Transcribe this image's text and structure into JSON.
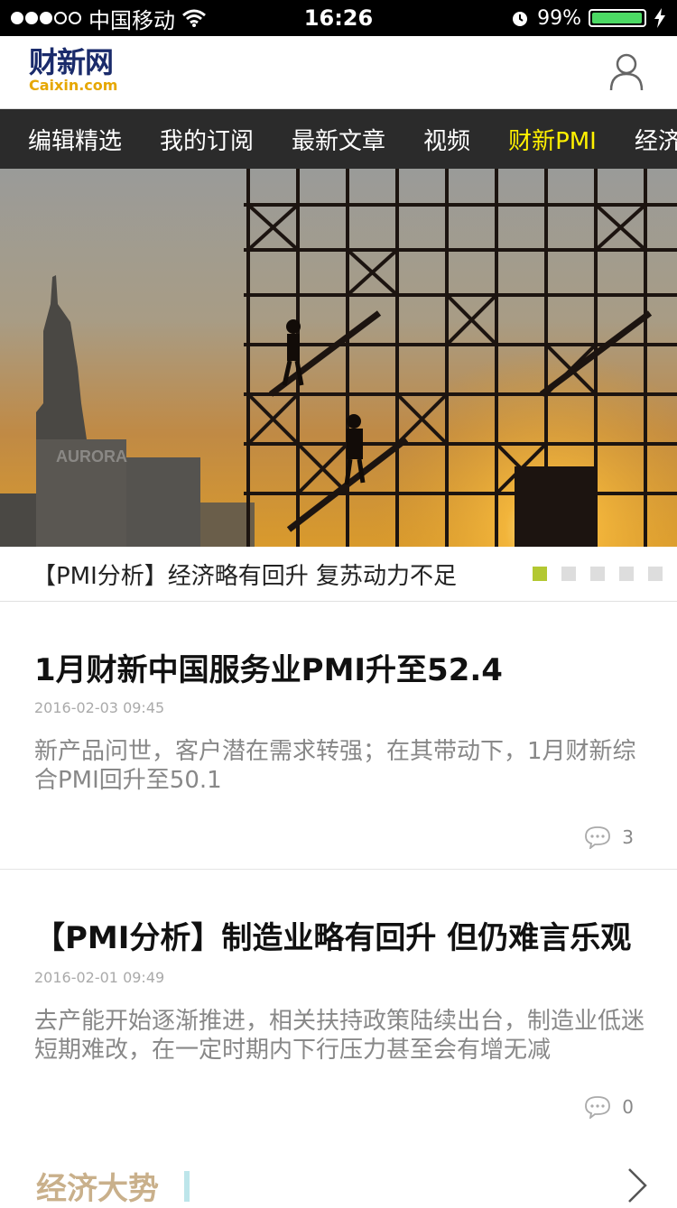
{
  "status_bar": {
    "carrier": "中国移动",
    "time": "16:26",
    "battery": "99%",
    "battery_level": 0.99
  },
  "header": {
    "logo_cn": "财新网",
    "logo_en": "Caixin.com"
  },
  "nav": {
    "tabs": [
      "编辑精选",
      "我的订阅",
      "最新文章",
      "视频",
      "财新PMI",
      "经济"
    ],
    "active_index": 4
  },
  "hero": {
    "caption": "【PMI分析】经济略有回升 复苏动力不足",
    "building_sign": "AURORA",
    "slides": 5,
    "active_slide": 1,
    "accent": "#b3c832"
  },
  "articles": [
    {
      "title": "1月财新中国服务业PMI升至52.4",
      "date": "2016-02-03 09:45",
      "summary": "新产品问世，客户潜在需求转强；在其带动下，1月财新综合PMI回升至50.1",
      "comments": "3"
    },
    {
      "title": "【PMI分析】制造业略有回升 但仍难言乐观",
      "date": "2016-02-01 09:49",
      "summary": "去产能开始逐渐推进，相关扶持政策陆续出台，制造业低迷短期难改，在一定时期内下行压力甚至会有增无减",
      "comments": "0"
    }
  ],
  "section": {
    "title": "经济大势"
  },
  "icons": {
    "user": "user-icon",
    "comment": "comment-icon",
    "more": "chevron-right-icon",
    "wifi": "wifi-icon",
    "alarm": "alarm-icon",
    "charging": "bolt-icon"
  },
  "colors": {
    "nav_bg": "#2b2b2b",
    "nav_active": "#fff100",
    "logo": "#1a2b6b",
    "logo_en": "#e6a700",
    "section_title": "#c9b08b"
  }
}
